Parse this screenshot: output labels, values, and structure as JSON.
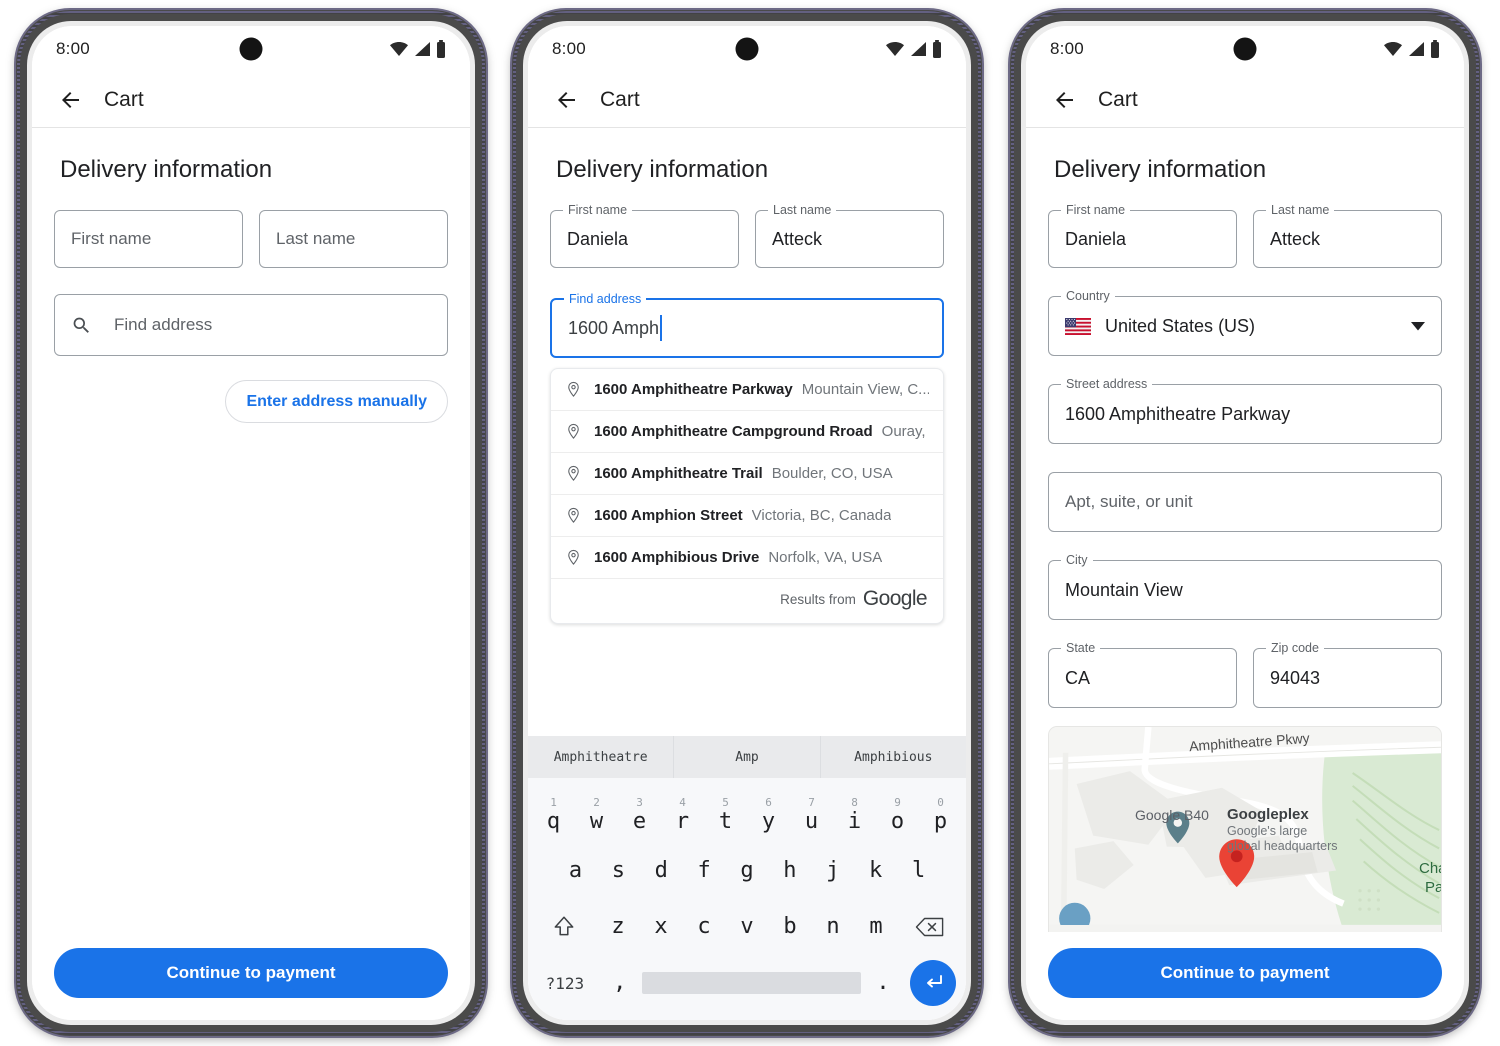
{
  "status_bar": {
    "time": "8:00",
    "icons": [
      "wifi-icon",
      "signal-icon",
      "battery-icon"
    ]
  },
  "appbar": {
    "title": "Cart",
    "back_icon": "back-arrow-icon"
  },
  "section": {
    "title": "Delivery information"
  },
  "colors": {
    "accent": "#1a73e8",
    "border": "#9aa0a6",
    "label": "#5f6368",
    "text": "#202124",
    "pin_red": "#ea4335"
  },
  "screen1": {
    "first_name": {
      "label": "First name",
      "placeholder": "First name",
      "value": ""
    },
    "last_name": {
      "label": "Last name",
      "placeholder": "Last name",
      "value": ""
    },
    "find_address": {
      "label": "Find address",
      "placeholder": "Find address",
      "value": "",
      "icon": "search-icon"
    },
    "manual_button": "Enter address manually",
    "cta": "Continue to payment"
  },
  "screen2": {
    "first_name": {
      "label": "First name",
      "value": "Daniela"
    },
    "last_name": {
      "label": "Last name",
      "value": "Atteck"
    },
    "find_address": {
      "label": "Find address",
      "value": "1600 Amph",
      "focused": true
    },
    "suggestions": [
      {
        "main": "1600 Amphitheatre Parkway",
        "sub": "Mountain View, C...",
        "icon": "location-pin-icon"
      },
      {
        "main": "1600 Amphitheatre Campground Rroad",
        "sub": "Ouray, ...",
        "icon": "location-pin-icon"
      },
      {
        "main": "1600 Amphitheatre Trail",
        "sub": "Boulder, CO, USA",
        "icon": "location-pin-icon"
      },
      {
        "main": "1600 Amphion Street",
        "sub": "Victoria, BC, Canada",
        "icon": "location-pin-icon"
      },
      {
        "main": "1600 Amphibious Drive",
        "sub": "Norfolk, VA, USA",
        "icon": "location-pin-icon"
      }
    ],
    "suggestions_footer": {
      "text": "Results from",
      "brand": "Google"
    },
    "keyboard": {
      "suggestions": [
        "Amphitheatre",
        "Amp",
        "Amphibious"
      ],
      "row1": [
        {
          "num": "1",
          "ch": "q"
        },
        {
          "num": "2",
          "ch": "w"
        },
        {
          "num": "3",
          "ch": "e"
        },
        {
          "num": "4",
          "ch": "r"
        },
        {
          "num": "5",
          "ch": "t"
        },
        {
          "num": "6",
          "ch": "y"
        },
        {
          "num": "7",
          "ch": "u"
        },
        {
          "num": "8",
          "ch": "i"
        },
        {
          "num": "9",
          "ch": "o"
        },
        {
          "num": "0",
          "ch": "p"
        }
      ],
      "row2": [
        "a",
        "s",
        "d",
        "f",
        "g",
        "h",
        "j",
        "k",
        "l"
      ],
      "row3": [
        "z",
        "x",
        "c",
        "v",
        "b",
        "n",
        "m"
      ],
      "shift_icon": "shift-icon",
      "backspace_icon": "backspace-icon",
      "symbols_key": "?123",
      "comma_key": ",",
      "period_key": ".",
      "enter_icon": "enter-icon"
    }
  },
  "screen3": {
    "first_name": {
      "label": "First name",
      "value": "Daniela"
    },
    "last_name": {
      "label": "Last name",
      "value": "Atteck"
    },
    "country": {
      "label": "Country",
      "value": "United States (US)",
      "flag": "us-flag-icon",
      "caret": "chevron-down-icon"
    },
    "street_address": {
      "label": "Street address",
      "value": "1600 Amphitheatre Parkway"
    },
    "apt": {
      "label": "",
      "placeholder": "Apt, suite, or unit",
      "value": ""
    },
    "city": {
      "label": "City",
      "value": "Mountain View"
    },
    "state": {
      "label": "State",
      "value": "CA"
    },
    "zip": {
      "label": "Zip code",
      "value": "94043"
    },
    "map": {
      "road_label": "Amphitheatre Pkwy",
      "poi_b40": "Google B40",
      "poi_plex": "Googleplex",
      "poi_plex_sub_1": "Google's large",
      "poi_plex_sub_2": "global headquarters",
      "park_label": "Charle",
      "park_label_2": "Par",
      "marker": "map-marker-icon"
    },
    "cta": "Continue to payment"
  }
}
